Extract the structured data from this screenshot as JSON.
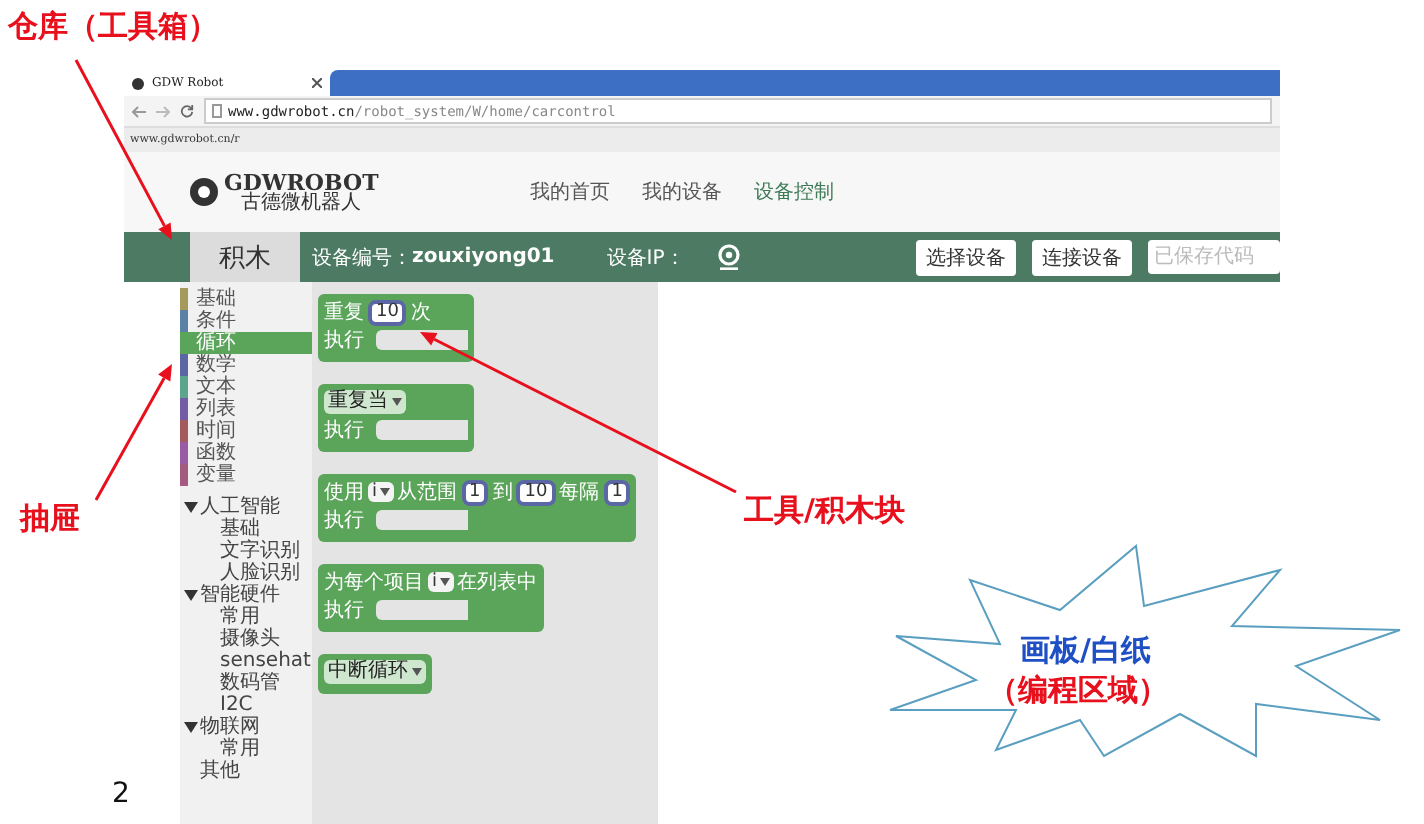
{
  "annotations": {
    "toolbox_label": "仓库（工具箱）",
    "drawer_label": "抽屉",
    "blocks_label": "工具/积木块",
    "canvas_callout": [
      {
        "text": "画板/白纸",
        "color": "#1f4fc4"
      },
      {
        "text": "（编程区域）",
        "color": "#e8101c"
      }
    ]
  },
  "browser": {
    "tab_title": "GDW Robot",
    "address": {
      "host": "www.gdwrobot.cn",
      "path": "/robot_system/W/home/carcontrol"
    },
    "bookmark": "www.gdwrobot.cn/r"
  },
  "site": {
    "logo": {
      "name": "GDWROBOT",
      "subtitle": "古德微机器人"
    },
    "nav": [
      {
        "label": "我的首页",
        "selected": false
      },
      {
        "label": "我的设备",
        "selected": false
      },
      {
        "label": "设备控制",
        "selected": true
      }
    ]
  },
  "toolbar": {
    "panel_tab": "积木",
    "device_id_label": "设备编号：",
    "device_id": "zouxiyong01",
    "device_ip_label": "设备IP：",
    "buttons": [
      "选择设备",
      "连接设备"
    ],
    "code_field": {
      "placeholder": "已保存代码"
    }
  },
  "toolbox": {
    "categories": [
      {
        "label": "基础",
        "color": "#a5995b",
        "selected": false
      },
      {
        "label": "条件",
        "color": "#5b80a5",
        "selected": false
      },
      {
        "label": "循环",
        "color": "#5ba55b",
        "selected": true
      },
      {
        "label": "数学",
        "color": "#5b67a5",
        "selected": false
      },
      {
        "label": "文本",
        "color": "#5ba58c",
        "selected": false
      },
      {
        "label": "列表",
        "color": "#745ba5",
        "selected": false
      },
      {
        "label": "时间",
        "color": "#a55b5b",
        "selected": false
      },
      {
        "label": "函数",
        "color": "#995ba5",
        "selected": false
      },
      {
        "label": "变量",
        "color": "#a55b80",
        "selected": false
      }
    ],
    "groups": [
      {
        "label": "人工智能",
        "expanded": true,
        "children": [
          {
            "label": "基础"
          },
          {
            "label": "文字识别"
          },
          {
            "label": "人脸识别"
          }
        ]
      },
      {
        "label": "智能硬件",
        "expanded": true,
        "children": [
          {
            "label": "常用"
          },
          {
            "label": "摄像头"
          },
          {
            "label": "sensehat"
          },
          {
            "label": "数码管"
          },
          {
            "label": "I2C"
          }
        ]
      },
      {
        "label": "物联网",
        "expanded": true,
        "children": [
          {
            "label": "常用"
          }
        ]
      },
      {
        "label": "其他"
      }
    ]
  },
  "blocks": [
    {
      "inputs": [
        {
          "kind": "label",
          "text": "重复"
        },
        {
          "kind": "number",
          "text": "10"
        },
        {
          "kind": "label",
          "text": "次"
        }
      ],
      "body_label": "执行"
    },
    {
      "inputs": [
        {
          "kind": "dropdown",
          "text": "重复当"
        }
      ],
      "body_label": "执行"
    },
    {
      "inputs": [
        {
          "kind": "label",
          "text": "使用"
        },
        {
          "kind": "variable",
          "text": "i"
        },
        {
          "kind": "label",
          "text": "从范围"
        },
        {
          "kind": "number",
          "text": "1"
        },
        {
          "kind": "label",
          "text": "到"
        },
        {
          "kind": "number",
          "text": "10"
        },
        {
          "kind": "label",
          "text": "每隔"
        },
        {
          "kind": "number",
          "text": "1"
        }
      ],
      "body_label": "执行"
    },
    {
      "inputs": [
        {
          "kind": "label",
          "text": "为每个项目"
        },
        {
          "kind": "variable",
          "text": "i"
        },
        {
          "kind": "label",
          "text": "在列表中"
        }
      ],
      "body_label": "执行"
    },
    {
      "inputs": [
        {
          "kind": "dropdown",
          "text": "中断循环"
        }
      ]
    }
  ],
  "page_number": "2"
}
